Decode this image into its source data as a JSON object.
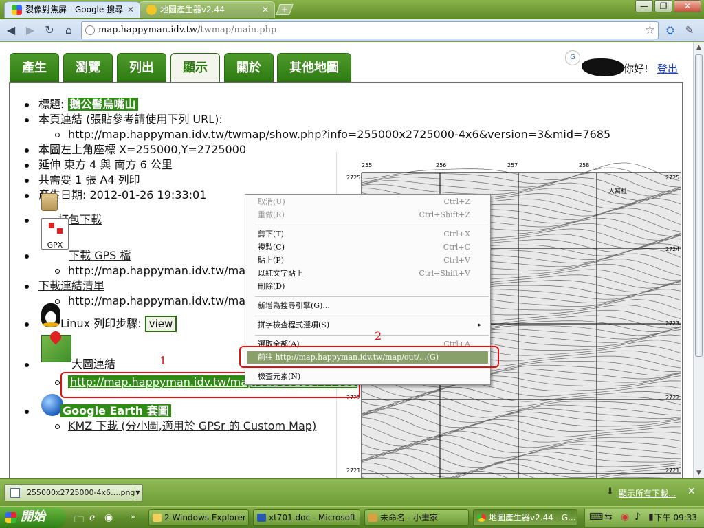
{
  "browser": {
    "tabs": [
      {
        "title": "裂像對焦屏 - Google 搜尋",
        "close": "✕"
      },
      {
        "title": "地圖產生器v2.44",
        "close": "✕"
      }
    ],
    "new_tab": "+",
    "window_controls": [
      "—",
      "❐",
      "✕"
    ],
    "url_host": "map.happyman.idv.tw",
    "url_path": "/twmap/main.php"
  },
  "nav_tabs": [
    "產生",
    "瀏覽",
    "列出",
    "顯示",
    "關於",
    "其他地圖"
  ],
  "selected_tab": "顯示",
  "user": {
    "badge": "G",
    "greeting": "你好!",
    "logout": "登出"
  },
  "info": {
    "title_label": "標題:",
    "title_value": "鵝公髻烏嘴山",
    "page_link_label": "本頁連結 (張貼參考請使用下列 URL):",
    "page_link_url": "http://map.happyman.idv.tw/twmap/show.php?info=255000x2725000-4x6&version=3&mid=7685",
    "coords": "本圖左上角座標 X=255000,Y=2725000",
    "extent": "延伸 東方 4 與 南方 6 公里",
    "pages": "共需要 1 張 A4 列印",
    "created": "產生日期: 2012-01-26 19:33:01",
    "zip_download": "打包下載",
    "gpx_label": "GPX",
    "gpx_download": "下載 GPS 檔",
    "gpx_url": "http://map.happyman.idv.tw/map.",
    "link_list": "下載連結清單",
    "link_list_url": "http://map.happyman.idv.tw/map.",
    "linux_steps": "Linux 列印步驟:",
    "view_button": "view",
    "big_map": "大圖連結",
    "big_map_url": "http://map.happyman.idv.tw/map/out/00155777685",
    "google_earth": "Google Earth 套圖",
    "kmz": "KMZ 下載 (分小圖,適用於 GPSr 的 Custom Map)"
  },
  "topo": {
    "x_ticks": [
      "255",
      "256",
      "257",
      "258"
    ],
    "y_ticks": [
      "2725",
      "2724",
      "2723",
      "2722",
      "2721"
    ],
    "place_label": "大窩社"
  },
  "context_menu": {
    "items": [
      {
        "label": "取消(U)",
        "shortcut": "Ctrl+Z",
        "disabled": true
      },
      {
        "label": "重做(R)",
        "shortcut": "Ctrl+Shift+Z",
        "disabled": true
      },
      {
        "label": "剪下(T)",
        "shortcut": "Ctrl+X",
        "disabled": false
      },
      {
        "label": "複製(C)",
        "shortcut": "Ctrl+C",
        "disabled": false
      },
      {
        "label": "貼上(P)",
        "shortcut": "Ctrl+V",
        "disabled": false
      },
      {
        "label": "以純文字貼上",
        "shortcut": "Ctrl+Shift+V",
        "disabled": false
      },
      {
        "label": "刪除(D)",
        "shortcut": "",
        "disabled": false
      },
      {
        "label": "新增為搜尋引擎(G)...",
        "shortcut": "",
        "disabled": false
      },
      {
        "label": "拼字檢查程式選項(S)",
        "shortcut": "",
        "disabled": false
      },
      {
        "label": "選取全部(A)",
        "shortcut": "Ctrl+A",
        "disabled": false
      },
      {
        "label": "前往 http://map.happyman.idv.tw/map/out/…(G)",
        "shortcut": "",
        "disabled": false
      },
      {
        "label": "檢查元素(N)",
        "shortcut": "",
        "disabled": false
      }
    ],
    "submenu_arrow": "▸"
  },
  "annotations": {
    "one": "1",
    "two": "2"
  },
  "download_bar": {
    "file": "255000x2725000-4x6….png",
    "show_all": "顯示所有下載...",
    "close": "✕"
  },
  "taskbar": {
    "start": "開始",
    "tasks": [
      "2 Windows Explorer",
      "xt701.doc - Microsoft ...",
      "未命名 - 小畫家",
      "地圖產生器v2.44 - G..."
    ],
    "clock": "下午 09:33"
  },
  "colors": {
    "green": "#2f8a16",
    "annotation": "#e01010",
    "menu_hover": "#8aa06a"
  }
}
